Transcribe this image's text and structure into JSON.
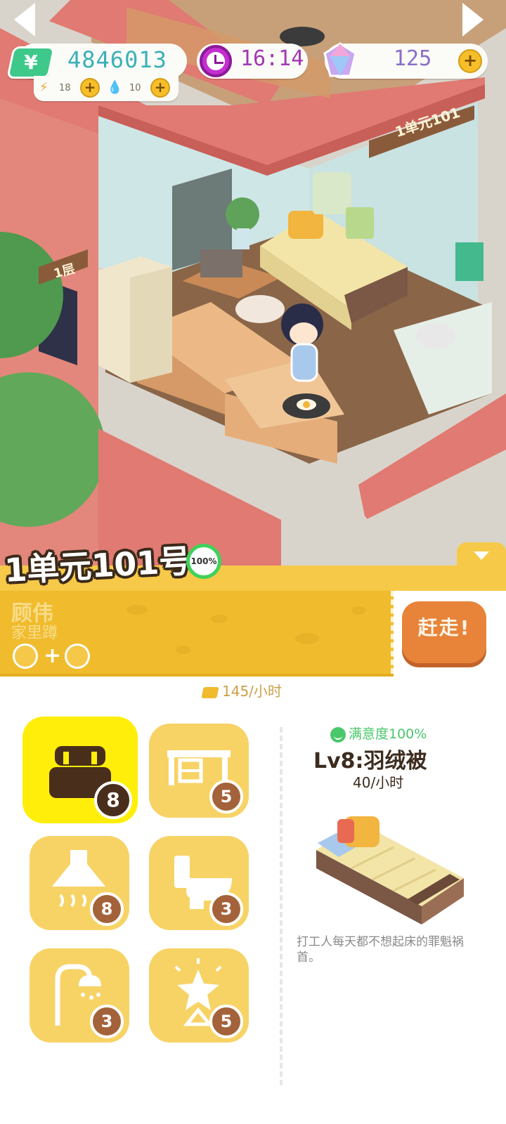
{
  "hud": {
    "money_symbol": "¥",
    "money": "4846013",
    "energy": "18",
    "water": "10",
    "time": "16:14",
    "gems": "125",
    "plus": "+"
  },
  "unit": {
    "building_label": "1单元101",
    "floor_label": "1层",
    "title": "1单元101号",
    "progress": "100%"
  },
  "tenant": {
    "name": "顾伟",
    "status": "家里蹲",
    "requirement_plus": "+",
    "evict_label": "赶走!",
    "income": "145/小时"
  },
  "furniture": [
    {
      "name": "bed",
      "icon": "bed-icon",
      "level": "8",
      "selected": true
    },
    {
      "name": "desk",
      "icon": "desk-icon",
      "level": "5",
      "selected": false
    },
    {
      "name": "range-hood",
      "icon": "range-hood-icon",
      "level": "8",
      "selected": false
    },
    {
      "name": "toilet",
      "icon": "toilet-icon",
      "level": "3",
      "selected": false
    },
    {
      "name": "shower",
      "icon": "shower-icon",
      "level": "3",
      "selected": false
    },
    {
      "name": "decoration",
      "icon": "star-lamp-icon",
      "level": "5",
      "selected": false
    }
  ],
  "detail": {
    "satisfaction": "满意度100%",
    "item_name": "Lv8:羽绒被",
    "rate": "40/小时",
    "description": "打工人每天都不想起床的罪魁祸首。"
  },
  "colors": {
    "accent_yellow": "#f7c948",
    "tile_yellow": "#f7d366",
    "selected_tile": "#ffee0a",
    "evict_orange": "#e7843a",
    "money_teal": "#3bb0b8",
    "satisfaction_green": "#49c76a"
  }
}
